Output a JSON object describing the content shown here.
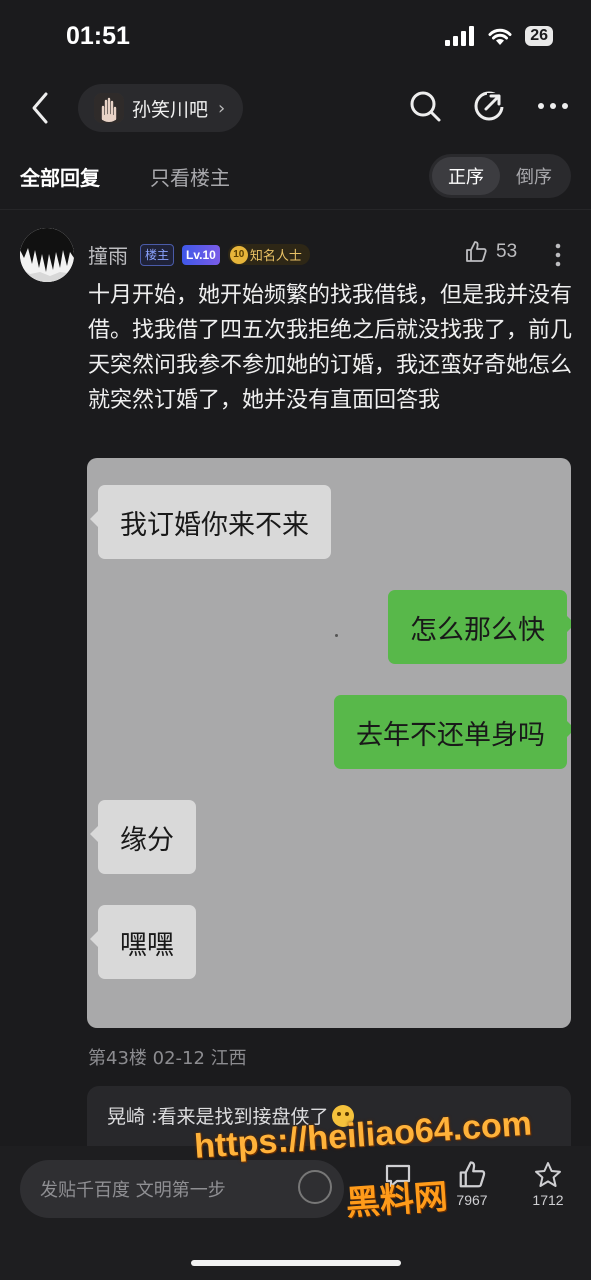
{
  "status_bar": {
    "time": "01:51",
    "battery": "26"
  },
  "nav": {
    "forum_name": "孙笑川吧",
    "chevron": "›"
  },
  "tabs": {
    "all_replies": "全部回复",
    "owner_only": "只看楼主",
    "order_asc": "正序",
    "order_desc": "倒序"
  },
  "post": {
    "username": "撞雨",
    "badge_owner": "楼主",
    "badge_level": "Lv.10",
    "badge_known_level": "10",
    "badge_known": "知名人士",
    "likes": "53",
    "text": "十月开始，她开始频繁的找我借钱，但是我并没有借。找我借了四五次我拒绝之后就没找我了，前几天突然问我参不参加她的订婚，我还蛮好奇她怎么就突然订婚了，她并没有直面回答我",
    "chat": [
      {
        "side": "left",
        "text": "我订婚你来不来"
      },
      {
        "side": "right",
        "text": "怎么那么快"
      },
      {
        "side": "right",
        "text": "去年不还单身吗"
      },
      {
        "side": "left",
        "text": "缘分"
      },
      {
        "side": "left",
        "text": "嘿嘿"
      }
    ],
    "meta": "第43楼 02-12 江西"
  },
  "comment": {
    "text": "晃崎 :看来是找到接盘侠了"
  },
  "bottom_bar": {
    "input_placeholder": "发贴千百度 文明第一步",
    "like_count": "7967",
    "fav_count": "1712"
  },
  "watermark": {
    "url": "https://heiliao64.com",
    "cn": "黑料网"
  },
  "colors": {
    "background": "#1b1b1d",
    "accent_level": "#3f58e8",
    "known_gold": "#e7b53a",
    "chat_green": "#58b84a",
    "watermark": "#ffb23a"
  }
}
